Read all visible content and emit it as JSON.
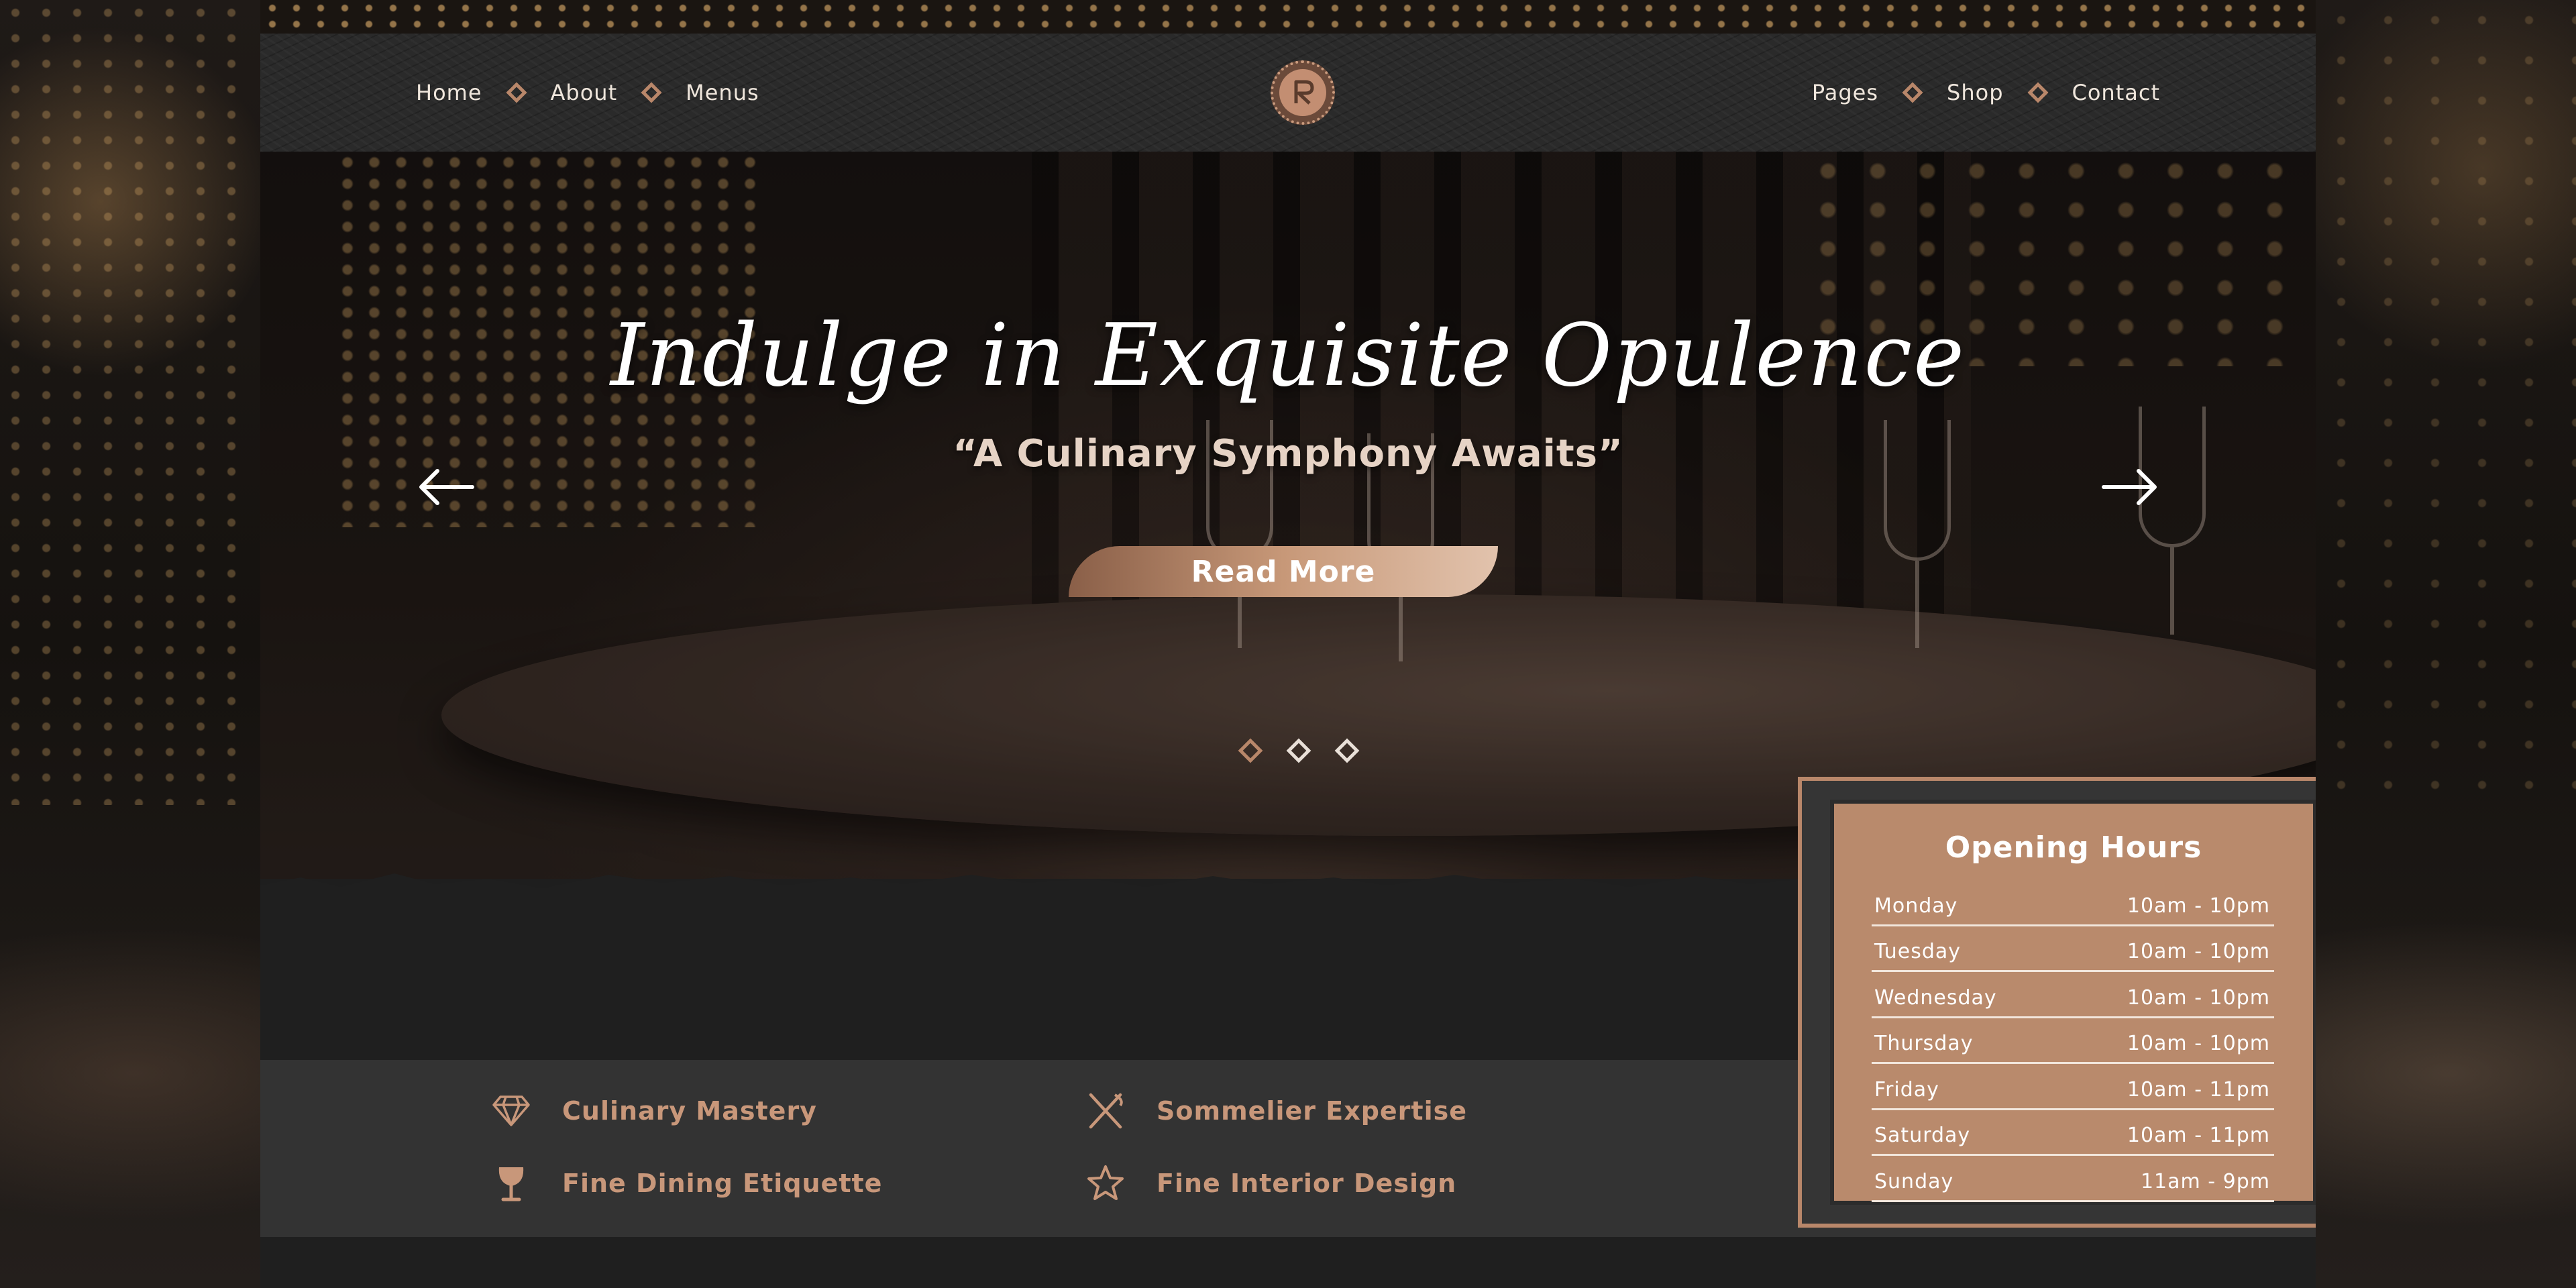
{
  "nav": {
    "left": [
      "Home",
      "About",
      "Menus"
    ],
    "right": [
      "Pages",
      "Shop",
      "Contact"
    ]
  },
  "hero": {
    "title": "Indulge in Exquisite Opulence",
    "subtitle": "“A Culinary Symphony Awaits”",
    "button": "Read More",
    "slide_count": 3,
    "active_slide": 1
  },
  "features": [
    {
      "label": "Culinary Mastery",
      "icon": "diamond-icon"
    },
    {
      "label": "Sommelier Expertise",
      "icon": "utensils-icon"
    },
    {
      "label": "Fine Dining Etiquette",
      "icon": "wine-glass-icon"
    },
    {
      "label": "Fine Interior Design",
      "icon": "star-icon"
    }
  ],
  "hours": {
    "title": "Opening Hours",
    "rows": [
      {
        "day": "Monday",
        "time": "10am - 10pm"
      },
      {
        "day": "Tuesday",
        "time": "10am - 10pm"
      },
      {
        "day": "Wednesday",
        "time": "10am - 10pm"
      },
      {
        "day": "Thursday",
        "time": "10am - 10pm"
      },
      {
        "day": "Friday",
        "time": "10am - 11pm"
      },
      {
        "day": "Saturday",
        "time": "10am - 11pm"
      },
      {
        "day": "Sunday",
        "time": "11am - 9pm"
      }
    ]
  },
  "colors": {
    "accent": "#b9876a",
    "card": "#b98a6c",
    "header": "#2a2a2a",
    "features_bg": "#333333"
  }
}
